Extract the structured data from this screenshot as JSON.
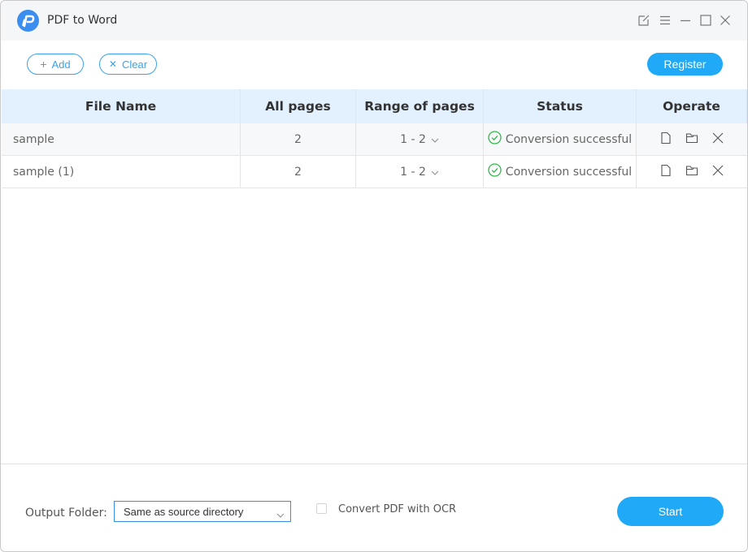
{
  "app": {
    "title": "PDF to Word",
    "logo_icon": "pdf-logo-icon"
  },
  "window_controls": [
    {
      "name": "feedback-icon"
    },
    {
      "name": "menu-icon"
    },
    {
      "name": "minimize-icon"
    },
    {
      "name": "maximize-icon"
    },
    {
      "name": "close-icon"
    }
  ],
  "toolbar": {
    "add_label": "Add",
    "add_icon": "+",
    "clear_label": "Clear",
    "clear_icon": "✕",
    "register_label": "Register"
  },
  "table": {
    "columns": [
      "File Name",
      "All pages",
      "Range of pages",
      "Status",
      "Operate"
    ],
    "rows": [
      {
        "file_name": "sample",
        "all_pages": "2",
        "range": "1 - 2",
        "status": "Conversion successful"
      },
      {
        "file_name": "sample (1)",
        "all_pages": "2",
        "range": "1 - 2",
        "status": "Conversion successful"
      }
    ]
  },
  "footer": {
    "output_folder_label": "Output Folder:",
    "output_folder_value": "Same as source directory",
    "ocr_label": "Convert PDF with OCR",
    "ocr_checked": false,
    "start_label": "Start"
  },
  "colors": {
    "accent": "#1fa9f7",
    "header_bg": "#e3f0fd",
    "success": "#2fb84a"
  }
}
